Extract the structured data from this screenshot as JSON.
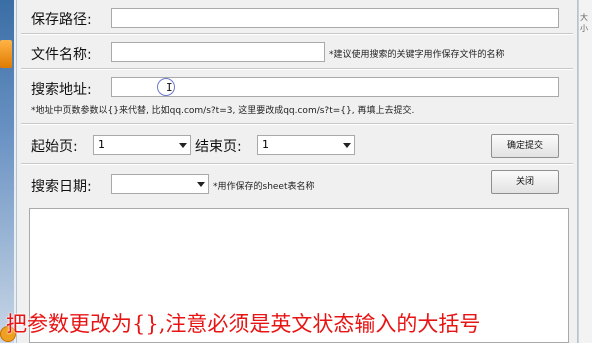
{
  "form": {
    "save_path_label": "保存路径:",
    "save_path_value": "",
    "file_name_label": "文件名称:",
    "file_name_value": "",
    "file_name_hint": "*建议使用搜索的关键字用作保存文件的名称",
    "search_url_label": "搜索地址:",
    "search_url_value": "",
    "search_url_hint": "*地址中页数参数以{}来代替, 比如qq.com/s?t=3, 这里要改成qq.com/s?t={}, 再填上去提交.",
    "start_page_label": "起始页:",
    "start_page_value": "1",
    "end_page_label": "结束页:",
    "end_page_value": "1",
    "submit_button": "确定提交",
    "search_date_label": "搜索日期:",
    "search_date_value": "",
    "search_date_hint": "*用作保存的sheet表名称",
    "close_button": "关闭",
    "output_text": ""
  },
  "caption": {
    "line1": "把参数更改为{},注意必须是英文状态输入的大括号"
  },
  "side": {
    "right_text": "大小"
  },
  "colors": {
    "caption": "#e81414",
    "window_bg": "#f0f0f0"
  }
}
